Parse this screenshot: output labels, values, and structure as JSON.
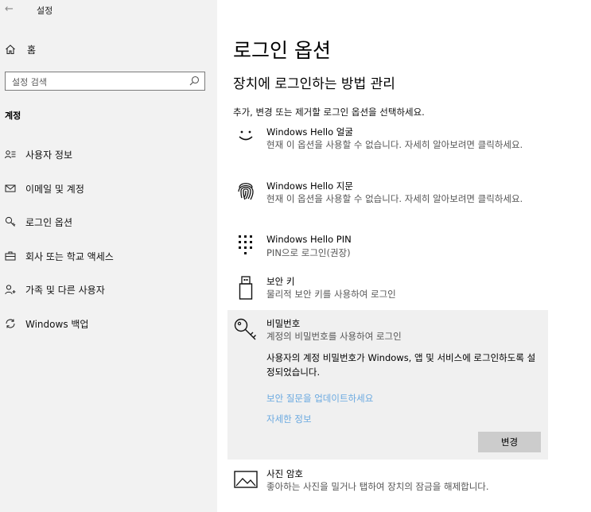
{
  "app": {
    "title": "설정"
  },
  "sidebar": {
    "home_label": "홈",
    "search_placeholder": "설정 검색",
    "section_title": "계정",
    "items": [
      {
        "label": "사용자 정보",
        "icon": "user-info-icon"
      },
      {
        "label": "이메일 및 계정",
        "icon": "mail-icon"
      },
      {
        "label": "로그인 옵션",
        "icon": "key-icon"
      },
      {
        "label": "회사 또는 학교 액세스",
        "icon": "briefcase-icon"
      },
      {
        "label": "가족 및 다른 사용자",
        "icon": "person-add-icon"
      },
      {
        "label": "Windows 백업",
        "icon": "sync-icon"
      }
    ]
  },
  "main": {
    "title": "로그인 옵션",
    "subtitle": "장치에 로그인하는 방법 관리",
    "description": "추가, 변경 또는 제거할 로그인 옵션을 선택하세요.",
    "options": [
      {
        "title": "Windows Hello 얼굴",
        "subtitle": "현재 이 옵션을 사용할 수 없습니다. 자세히 알아보려면 클릭하세요.",
        "icon": "face-icon"
      },
      {
        "title": "Windows Hello 지문",
        "subtitle": "현재 이 옵션을 사용할 수 없습니다. 자세히 알아보려면 클릭하세요.",
        "icon": "fingerprint-icon"
      },
      {
        "title": "Windows Hello PIN",
        "subtitle": "PIN으로 로그인(권장)",
        "icon": "pin-keypad-icon"
      },
      {
        "title": "보안 키",
        "subtitle": "물리적 보안 키를 사용하여 로그인",
        "icon": "usb-key-icon"
      },
      {
        "title": "비밀번호",
        "subtitle": "계정의 비밀번호를 사용하여 로그인",
        "icon": "password-key-icon"
      },
      {
        "title": "사진 암호",
        "subtitle": "좋아하는 사진을 밀거나 탭하여 장치의 잠금을 해제합니다.",
        "icon": "picture-icon"
      }
    ],
    "password_detail": "사용자의 계정 비밀번호가 Windows, 앱 및 서비스에 로그인하도록 설정되었습니다.",
    "link_update_questions": "보안 질문을 업데이트하세요",
    "link_more_info": "자세한 정보",
    "change_button": "변경"
  },
  "colors": {
    "sidebar_bg": "#f2f2f2",
    "selected_bg": "#f0f0f0",
    "link": "#6aa9e0",
    "button_bg": "#cccccc"
  }
}
